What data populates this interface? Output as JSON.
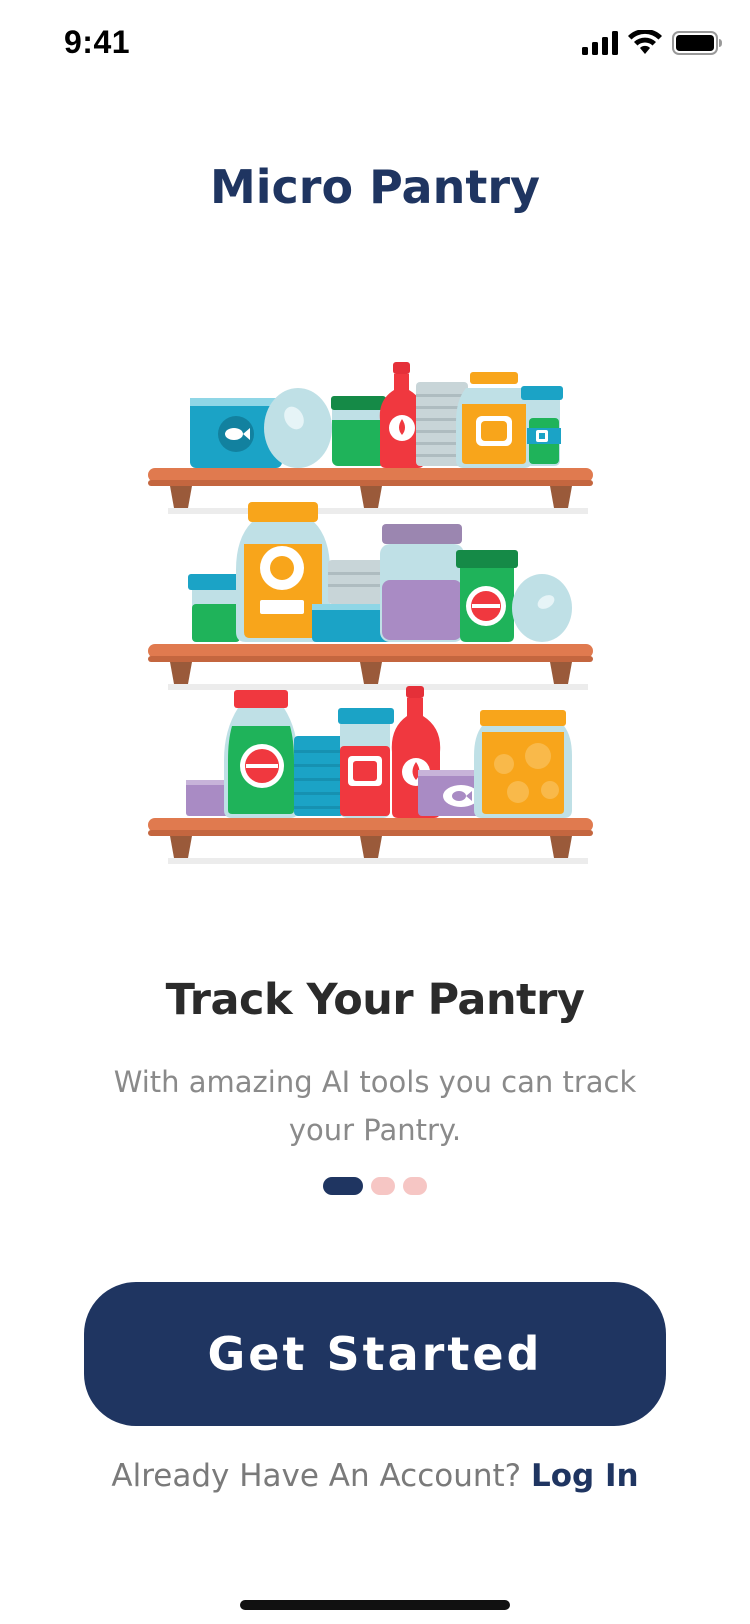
{
  "status_bar": {
    "time": "9:41",
    "icons": [
      "cellular-signal-icon",
      "wifi-icon",
      "battery-icon"
    ]
  },
  "app": {
    "title": "Micro Pantry"
  },
  "illustration": {
    "name": "pantry-shelves-illustration",
    "colors": {
      "shelf": "#e07a4f",
      "shelf_bracket": "#9a5a3a",
      "blue": "#1ba3c6",
      "green": "#1fb35a",
      "red": "#f0383f",
      "orange": "#f8a51b",
      "purple": "#a98bc4",
      "glass": "#bfe0e6"
    }
  },
  "onboarding": {
    "title": "Track Your Pantry",
    "subtitle": "With amazing AI tools you can track your Pantry.",
    "page_count": 3,
    "active_page": 1
  },
  "cta": {
    "label": "Get Started"
  },
  "login": {
    "prompt": "Already Have An Account?",
    "link_label": "Log In"
  },
  "colors": {
    "primary": "#1f3561",
    "dot_inactive": "#f6c6c4",
    "subtitle": "#8a8a8a"
  }
}
